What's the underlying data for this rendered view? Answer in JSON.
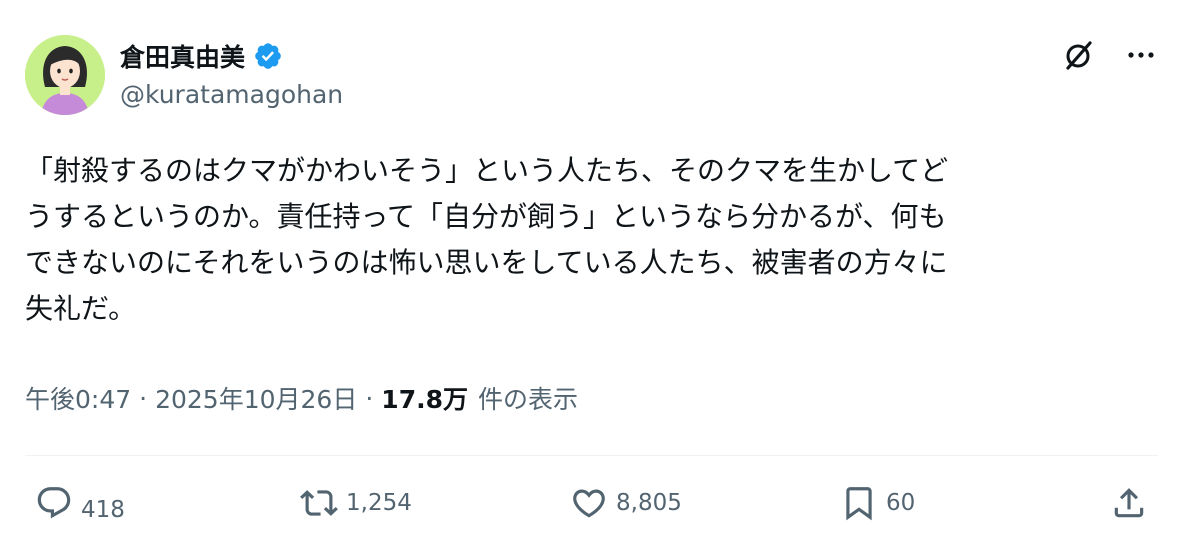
{
  "author": {
    "display_name": "倉田真由美",
    "handle": "@kuratamagohan",
    "verified": true
  },
  "tweet": {
    "lines": [
      "「射殺するのはクマがかわいそう」という人たち、そのクマを生かしてど",
      "うするというのか。責任持って「自分が飼う」というなら分かるが、何も",
      "できないのにそれをいうのは怖い思いをしている人たち、被害者の方々に",
      "失礼だ。"
    ]
  },
  "meta": {
    "time": "午後0:47",
    "separator": "·",
    "date": "2025年10月26日",
    "views_count": "17.8万",
    "views_label": "件の表示"
  },
  "actions": {
    "reply_count": "418",
    "retweet_count": "1,254",
    "like_count": "8,805",
    "bookmark_count": "60"
  },
  "icons": {
    "verified": "verified-badge-icon",
    "grok": "grok-icon",
    "more": "more-icon",
    "reply": "reply-icon",
    "retweet": "retweet-icon",
    "like": "heart-icon",
    "bookmark": "bookmark-icon",
    "share": "share-icon"
  },
  "colors": {
    "text": "#0f1419",
    "secondary": "#536471",
    "verified": "#1d9bf0",
    "avatar_bg": "#c8f08a",
    "divider": "#eff3f4"
  }
}
